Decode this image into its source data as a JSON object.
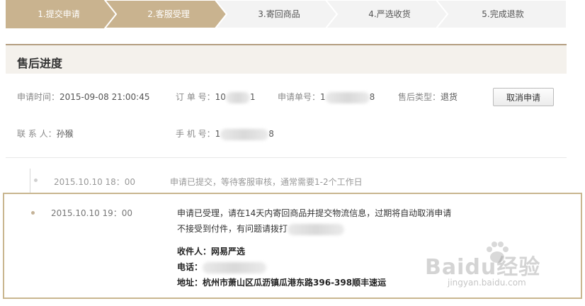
{
  "steps": [
    {
      "label": "1.提交申请"
    },
    {
      "label": "2.客服受理"
    },
    {
      "label": "3.寄回商品"
    },
    {
      "label": "4.严选收货"
    },
    {
      "label": "5.完成退款"
    }
  ],
  "panel": {
    "title": "售后进度"
  },
  "info": {
    "apply_time_label": "申请时间：",
    "apply_time": "2015-09-08  21:00:45",
    "order_no_label": "订 单 号：",
    "order_no_start": "10",
    "order_no_end": "1",
    "apply_no_label": "申请单号：",
    "apply_no_start": "1",
    "apply_no_end": "8",
    "type_label": "售后类型：",
    "type": "退货",
    "contact_label": "联 系 人：",
    "contact": "孙猴",
    "phone_label": "手 机 号：",
    "phone_start": "1",
    "phone_end": "8"
  },
  "cancel_button": "取消申请",
  "timeline": [
    {
      "time": "2015.10.10  18：00",
      "message": "申请已提交，等待客服审核，通常需要1-2个工作日"
    },
    {
      "time": "2015.10.10  19：00",
      "message_line1": "申请已受理，请在14天内寄回商品并提交物流信息，过期将自动取消申请",
      "message_line2": "不接受到付件，有问题请拨打",
      "receiver_label": "收件人：",
      "receiver": "网易严选",
      "phone_label": "电话：",
      "address_label": "地址：",
      "address": "杭州市萧山区瓜沥镇瓜港东路396-398顺丰速运"
    }
  ],
  "watermark": {
    "brand": "Baidu经验",
    "sub": "jingyan.baidu.com"
  },
  "colors": {
    "step_active": "#c9b38f",
    "step_inactive": "#f3f3f3",
    "accent": "#b49e80"
  }
}
